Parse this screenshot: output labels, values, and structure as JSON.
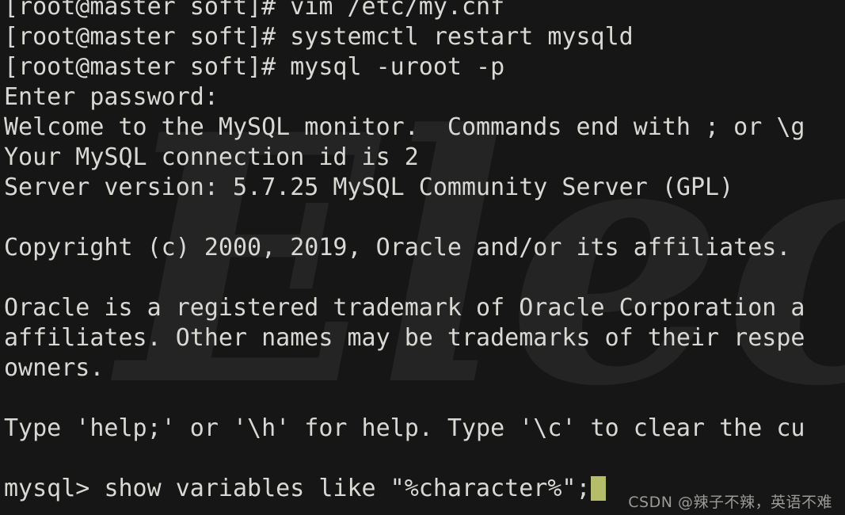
{
  "terminal": {
    "background_color": "#161616",
    "foreground_color": "#d8d8d4",
    "cursor_color": "#b5bd68",
    "prompt": "[root@master soft]# ",
    "lines": [
      {
        "id": "cmd-vim",
        "text": "[root@master soft]# vim /etc/my.cnf"
      },
      {
        "id": "cmd-systemctl",
        "text": "[root@master soft]# systemctl restart mysqld"
      },
      {
        "id": "cmd-mysql-login",
        "text": "[root@master soft]# mysql -uroot -p"
      },
      {
        "id": "out-enter-password",
        "text": "Enter password:"
      },
      {
        "id": "out-welcome",
        "text": "Welcome to the MySQL monitor.  Commands end with ; or \\g"
      },
      {
        "id": "out-connection-id",
        "text": "Your MySQL connection id is 2"
      },
      {
        "id": "out-server-version",
        "text": "Server version: 5.7.25 MySQL Community Server (GPL)"
      },
      {
        "id": "blank-1",
        "text": ""
      },
      {
        "id": "out-copyright",
        "text": "Copyright (c) 2000, 2019, Oracle and/or its affiliates."
      },
      {
        "id": "blank-2",
        "text": ""
      },
      {
        "id": "out-trademark-1",
        "text": "Oracle is a registered trademark of Oracle Corporation a"
      },
      {
        "id": "out-trademark-2",
        "text": "affiliates. Other names may be trademarks of their respe"
      },
      {
        "id": "out-trademark-3",
        "text": "owners."
      },
      {
        "id": "blank-3",
        "text": ""
      },
      {
        "id": "out-help",
        "text": "Type 'help;' or '\\h' for help. Type '\\c' to clear the cu"
      },
      {
        "id": "blank-4",
        "text": ""
      }
    ],
    "current_prompt": {
      "prompt": "mysql> ",
      "command": "show variables like \"%character%\";",
      "cursor": "block-cursor"
    }
  },
  "watermarks": {
    "background_text": "Electr",
    "background_color": "#242424",
    "csdn": "CSDN @辣子不辣，英语不难"
  }
}
